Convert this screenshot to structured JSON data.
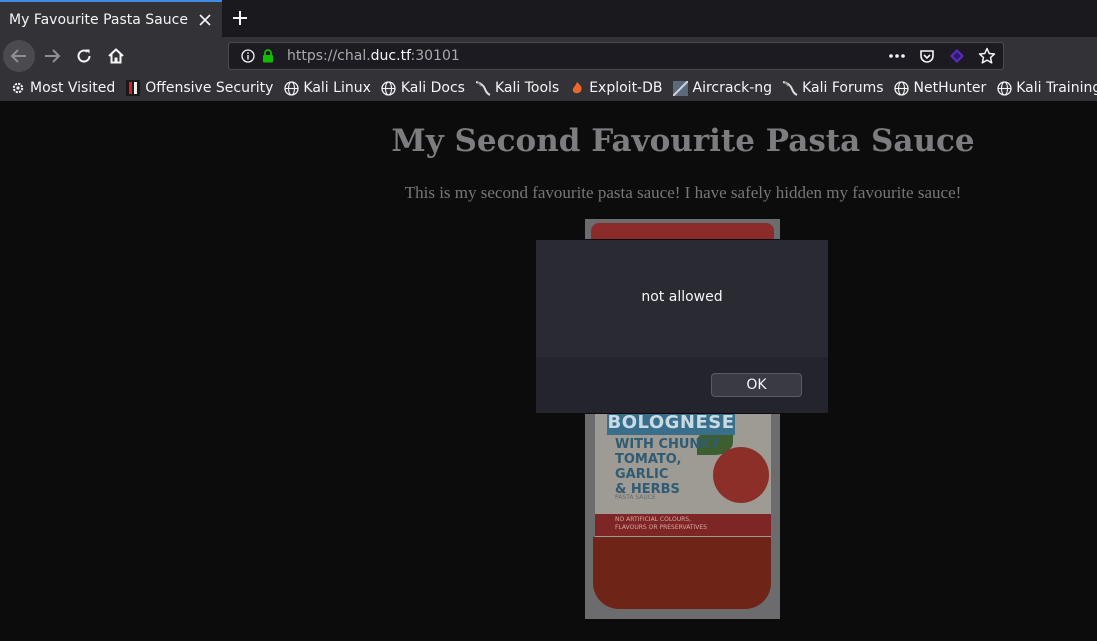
{
  "browser": {
    "tab": {
      "title": "My Favourite Pasta Sauce",
      "close_icon": "close-icon"
    },
    "new_tab_icon": "plus-icon",
    "nav": {
      "back_icon": "back-arrow-icon",
      "forward_icon": "forward-arrow-icon",
      "reload_icon": "reload-icon",
      "home_icon": "home-icon"
    },
    "urlbar": {
      "scheme": "https://chal.",
      "host": "duc.tf",
      "port": ":30101",
      "info_icon": "info-icon",
      "lock_icon": "lock-icon",
      "lock_color": "#12bc00"
    },
    "url_actions": [
      "more-icon",
      "pocket-icon",
      "extension-icon",
      "star-icon"
    ],
    "bookmarks": [
      {
        "label": "Most Visited",
        "icon": "gear-icon"
      },
      {
        "label": "Offensive Security",
        "icon": "offsec-icon"
      },
      {
        "label": "Kali Linux",
        "icon": "globe-icon"
      },
      {
        "label": "Kali Docs",
        "icon": "globe-icon"
      },
      {
        "label": "Kali Tools",
        "icon": "kali-dragon-icon"
      },
      {
        "label": "Exploit-DB",
        "icon": "exploitdb-icon"
      },
      {
        "label": "Aircrack-ng",
        "icon": "aircrack-icon"
      },
      {
        "label": "Kali Forums",
        "icon": "kali-dragon-icon"
      },
      {
        "label": "NetHunter",
        "icon": "globe-icon"
      },
      {
        "label": "Kali Training",
        "icon": "globe-icon"
      }
    ]
  },
  "page": {
    "title": "My Second Favourite Pasta Sauce",
    "description": "This is my second favourite pasta sauce! I have safely hidden my favourite sauce!",
    "jar": {
      "brand": "BOLOGNESE",
      "subtitle": "WITH CHUNKY\nTOMATO, GARLIC\n& HERBS",
      "type": "PASTA SAUCE",
      "fine_print": "NO ARTIFICIAL COLOURS,\nFLAVOURS OR PRESERVATIVES"
    }
  },
  "dialog": {
    "message": "not allowed",
    "ok_label": "OK"
  },
  "colors": {
    "accent": "#3f8ee6",
    "chrome": "#323237",
    "page_background": "#0c0c0d"
  }
}
